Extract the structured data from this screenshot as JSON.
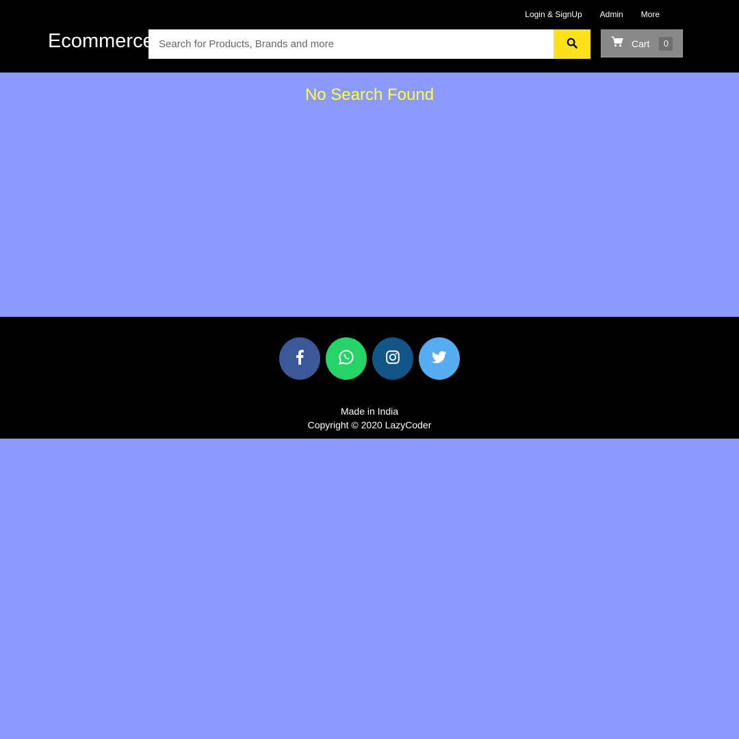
{
  "nav": {
    "login_label": "Login & SignUp",
    "admin_label": "Admin",
    "more_label": "More"
  },
  "brand": {
    "name": "Ecommerce"
  },
  "search": {
    "placeholder": "Search for Products, Brands and more",
    "value": ""
  },
  "cart": {
    "label": "Cart",
    "count": "0"
  },
  "main": {
    "message": "No Search Found"
  },
  "footer": {
    "socials": [
      "facebook-icon",
      "whatsapp-icon",
      "instagram-icon",
      "twitter-icon"
    ],
    "made_in": "Made in India",
    "copyright": "Copyright © 2020 LazyCoder"
  },
  "colors": {
    "page_bg": "#8c9aff",
    "header_bg": "#000000",
    "accent_yellow": "#ffe11b",
    "message_color": "#ffff3b",
    "facebook": "#3b5998",
    "whatsapp": "#25d366",
    "instagram": "#125688",
    "twitter": "#55acee"
  }
}
